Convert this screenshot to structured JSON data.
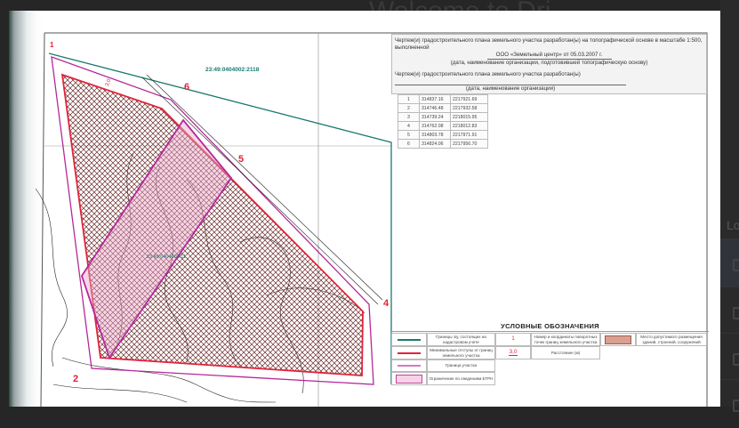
{
  "background_page": {
    "title_fragment": "Welcome to Dri",
    "panel_heading_fragment": "Lo"
  },
  "header": {
    "line1": "Чертеж(и) градостроительного плана земельного участка разработан(ы) на топографической основе в масштабе 1:500, выполненной",
    "line2": "ООО «Земельный центр» от 05.03.2007 г.",
    "caption1": "(дата, наименование организации, подготовившей топографическую основу)",
    "line3": "Чертеж(и) градостроительного плана земельного участка разработан(ы)",
    "caption2": "(дата, наименование организации)"
  },
  "coordinates": [
    {
      "n": "1",
      "x": "314837.16",
      "y": "2217921.69"
    },
    {
      "n": "2",
      "x": "314746.48",
      "y": "2217932.58"
    },
    {
      "n": "3",
      "x": "314739.24",
      "y": "2218015.95"
    },
    {
      "n": "4",
      "x": "314762.08",
      "y": "2218012.83"
    },
    {
      "n": "5",
      "x": "314803.78",
      "y": "2217971.91"
    },
    {
      "n": "6",
      "x": "314824.06",
      "y": "2217956.70"
    }
  ],
  "map": {
    "cadastral_neighbor": "23:49:0404002:2118",
    "cadastral_parcel": "23:49:0404002:11",
    "point_labels": [
      "1",
      "2",
      "4",
      "5",
      "6"
    ],
    "setback": "3,0",
    "colors": {
      "teal": "#1a7a6e",
      "red": "#e0233a",
      "magenta": "#b5289a",
      "pink": "#f2c6dd",
      "hatch": "#6b2a2a"
    }
  },
  "legend": {
    "title": "УСЛОВНЫЕ ОБОЗНАЧЕНИЯ",
    "items": [
      "Границы з/у, состоящих на кадастровом учете",
      "Минимальные отступы от границ земельного участка",
      "Граница участка",
      "Ограничение по сведениям ЕГРН",
      "Номер и координаты поворотных точек границ земельного участка",
      "Расстояние (м)",
      "Место допустимого размещения зданий, строений, сооружений"
    ],
    "sample_point": "1",
    "sample_distance": "3,0"
  }
}
